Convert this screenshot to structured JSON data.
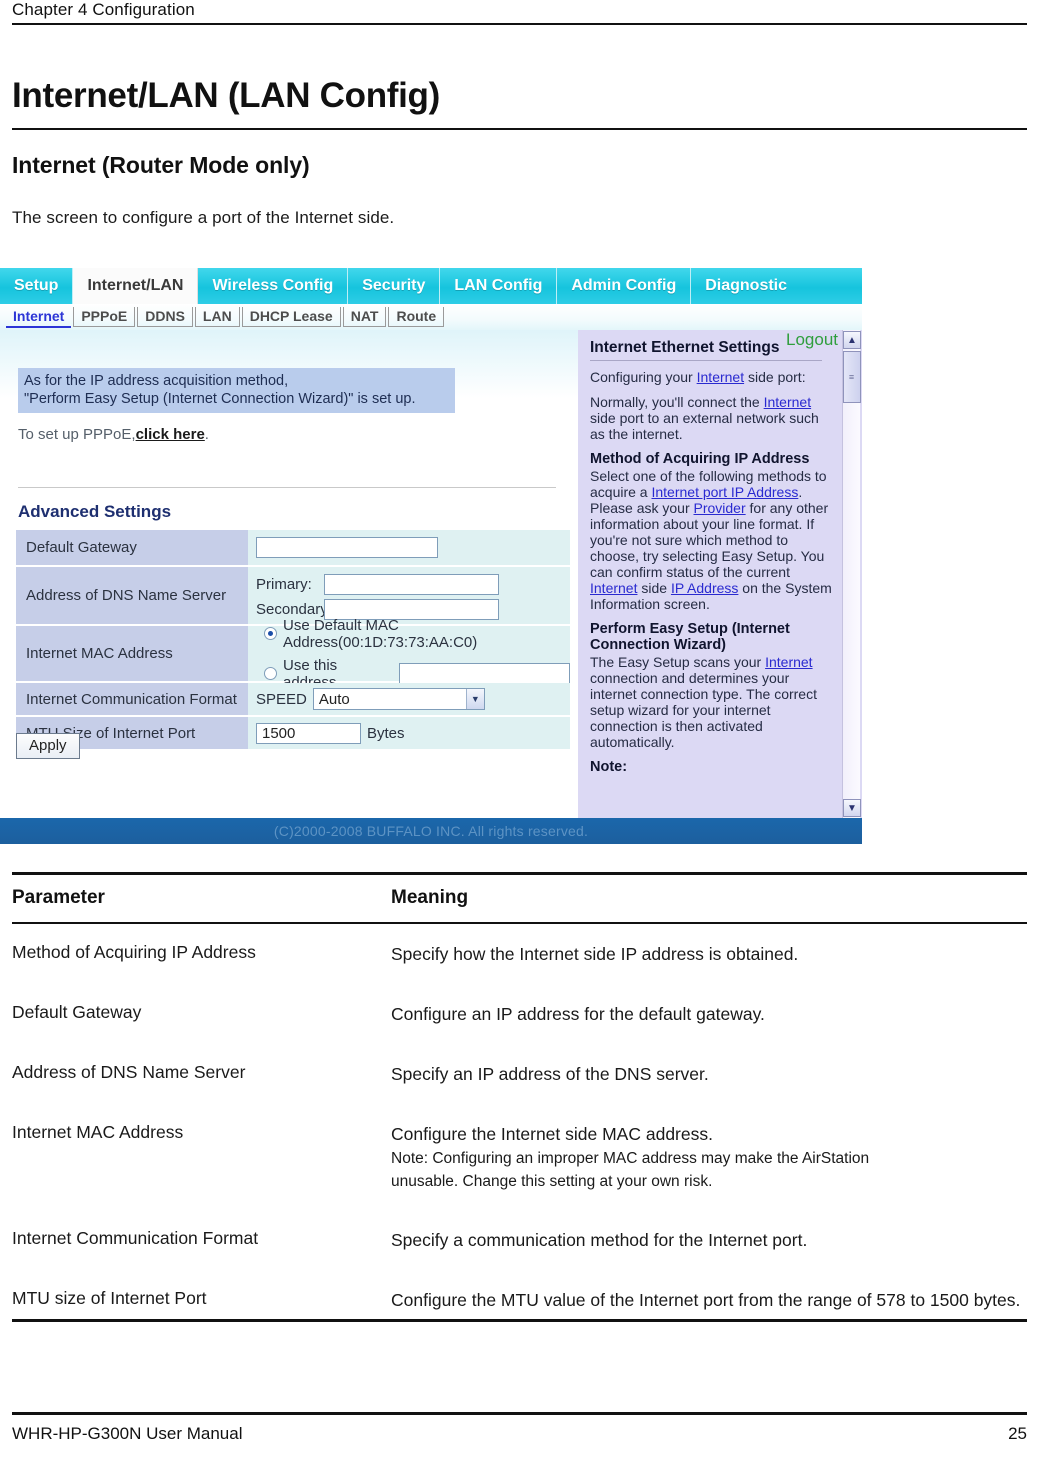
{
  "page": {
    "chapter": "Chapter 4  Configuration",
    "title": "Internet/LAN (LAN Config)",
    "section": "Internet (Router Mode only)",
    "intro": "The screen to configure a port of the Internet side.",
    "footer_left": "WHR-HP-G300N User Manual",
    "footer_page": "25"
  },
  "screenshot": {
    "nav_tabs": [
      {
        "label": "Setup",
        "active": false
      },
      {
        "label": "Internet/LAN",
        "active": true
      },
      {
        "label": "Wireless Config",
        "active": false
      },
      {
        "label": "Security",
        "active": false
      },
      {
        "label": "LAN Config",
        "active": false
      },
      {
        "label": "Admin Config",
        "active": false
      },
      {
        "label": "Diagnostic",
        "active": false
      }
    ],
    "sub_tabs": [
      {
        "label": "Internet",
        "active": true
      },
      {
        "label": "PPPoE",
        "active": false
      },
      {
        "label": "DDNS",
        "active": false
      },
      {
        "label": "LAN",
        "active": false
      },
      {
        "label": "DHCP Lease",
        "active": false
      },
      {
        "label": "NAT",
        "active": false
      },
      {
        "label": "Route",
        "active": false
      }
    ],
    "logout_label": "Logout",
    "notice_line1": "As for the IP address acquisition method,",
    "notice_line2": "\"Perform Easy Setup (Internet Connection Wizard)\" is set up.",
    "pppoe_prefix": "To set up PPPoE,",
    "pppoe_link": "click here",
    "pppoe_suffix": ".",
    "advanced_title": "Advanced Settings",
    "rows": {
      "default_gateway_label": "Default Gateway",
      "default_gateway_value": "",
      "dns_label": "Address of DNS Name Server",
      "dns_primary_label": "Primary:",
      "dns_primary_value": "",
      "dns_secondary_label": "Secondary:",
      "dns_secondary_value": "",
      "mac_label": "Internet MAC Address",
      "mac_default_option": "Use Default MAC Address(00:1D:73:73:AA:C0)",
      "mac_custom_option": "Use this address",
      "mac_custom_value": "",
      "comm_label": "Internet Communication Format",
      "comm_speed_label": "SPEED",
      "comm_speed_value": "Auto",
      "mtu_label": "MTU Size of Internet Port",
      "mtu_value": "1500",
      "mtu_units": "Bytes"
    },
    "apply_label": "Apply",
    "help": {
      "heading": "Internet Ethernet Settings",
      "p1_pre": "Configuring your ",
      "p1_link": "Internet",
      "p1_post": " side port:",
      "p2_pre": "Normally, you'll connect the ",
      "p2_link": "Internet",
      "p2_post": " side port to an external network such as the internet.",
      "h2_method": "Method of Acquiring IP Address",
      "p3_a": "Select one of the following methods to acquire a ",
      "p3_link1": "Internet port IP Address",
      "p3_b": ". Please ask your ",
      "p3_link2": "Provider",
      "p3_c": " for any other information about your line format. If you're not sure which method to choose, try selecting Easy Setup. You can confirm status of the current ",
      "p3_link3": "Internet",
      "p3_d": " side ",
      "p3_link4": "IP Address",
      "p3_e": " on the System Information screen.",
      "h2_easy": "Perform Easy Setup (Internet Connection Wizard)",
      "p4_a": "The Easy Setup scans your ",
      "p4_link": "Internet",
      "p4_b": " connection and determines your internet connection type. The correct setup wizard for your internet connection is then activated automatically.",
      "note_label": "Note:"
    },
    "copyright": "(C)2000-2008 BUFFALO INC. All rights reserved."
  },
  "param_table": {
    "headers": [
      "Parameter",
      "Meaning"
    ],
    "rows": [
      {
        "parameter": "Method of Acquiring IP Address",
        "meaning": "Specify how the Internet side IP address is obtained.",
        "note": "",
        "note_indent": ""
      },
      {
        "parameter": "Default Gateway",
        "meaning": "Configure an IP address for the default gateway.",
        "note": "",
        "note_indent": ""
      },
      {
        "parameter": "Address of DNS Name Server",
        "meaning": "Specify an IP address of the DNS server.",
        "note": "",
        "note_indent": ""
      },
      {
        "parameter": "Internet MAC Address",
        "meaning": "Configure the Internet side MAC address.",
        "note": "Note: Configuring an improper MAC address may make the AirStation",
        "note_indent": "unusable. Change this setting at your own risk."
      },
      {
        "parameter": "Internet Communication Format",
        "meaning": "Specify a communication method for the Internet port.",
        "note": "",
        "note_indent": ""
      },
      {
        "parameter": "MTU size of Internet Port",
        "meaning": "Configure the MTU value of the Internet port from the range of 578 to 1500 bytes.",
        "note": "",
        "note_indent": ""
      }
    ]
  }
}
